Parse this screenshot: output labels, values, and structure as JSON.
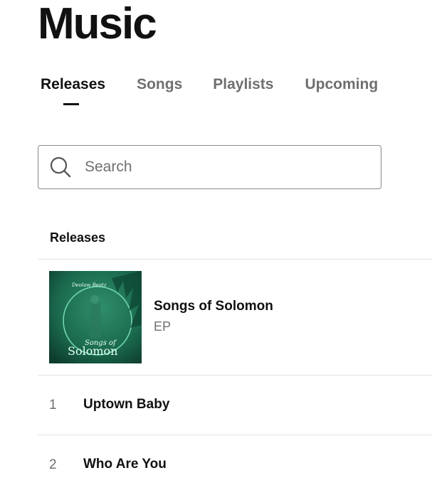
{
  "page": {
    "title": "Music"
  },
  "tabs": [
    {
      "label": "Releases",
      "active": true
    },
    {
      "label": "Songs",
      "active": false
    },
    {
      "label": "Playlists",
      "active": false
    },
    {
      "label": "Upcoming",
      "active": false
    }
  ],
  "search": {
    "placeholder": "Search",
    "value": "",
    "icon": "search-icon"
  },
  "releases_section": {
    "header": "Releases",
    "items": [
      {
        "title": "Songs of Solomon",
        "type": "EP",
        "cover": {
          "artist_text": "Deolaw Beatz",
          "title_line1": "Songs of",
          "title_line2": "Solomon",
          "background": "#1b6b4f",
          "accent": "#6fe0b4"
        }
      }
    ]
  },
  "tracks": [
    {
      "number": "1",
      "title": "Uptown Baby"
    },
    {
      "number": "2",
      "title": "Who Are You"
    }
  ],
  "colors": {
    "text_primary": "#111111",
    "text_secondary": "#6f6f6f",
    "divider": "#e3e3e3",
    "border": "#8a8a8a"
  }
}
